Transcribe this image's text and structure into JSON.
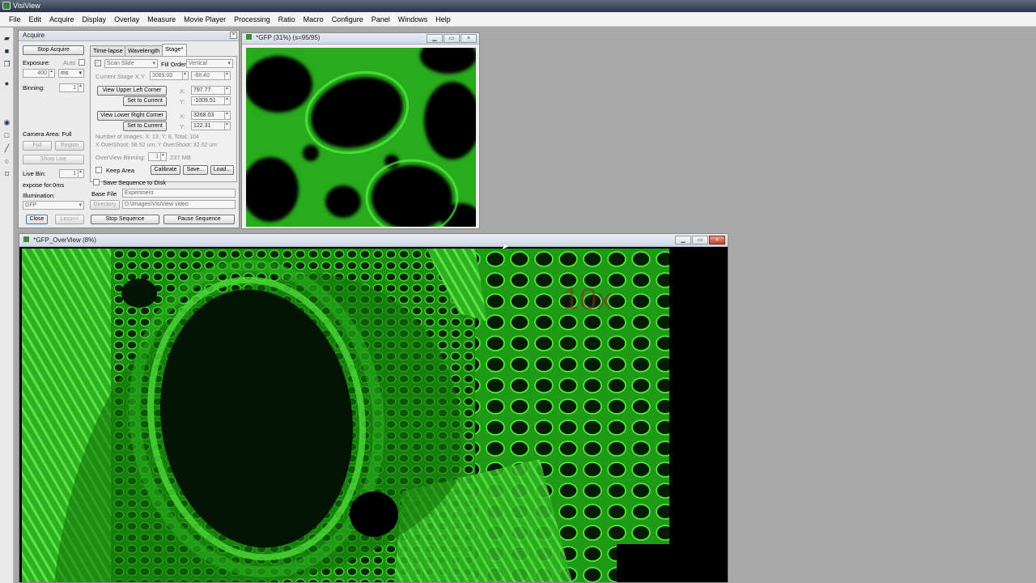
{
  "app": {
    "title": "VisiView"
  },
  "menu": [
    "File",
    "Edit",
    "Acquire",
    "Display",
    "Overlay",
    "Measure",
    "Movie Player",
    "Processing",
    "Ratio",
    "Macro",
    "Configure",
    "Panel",
    "Windows",
    "Help"
  ],
  "acquire": {
    "title": "Acquire",
    "stop_acquire": "Stop Acquire",
    "exposure_label": "Exposure:",
    "auto_label": "Auto",
    "exposure_value": "400",
    "exposure_unit": "ms",
    "binning_label": "Binning:",
    "binning_value": "1",
    "camera_area": "Camera Area: Full",
    "full": "Full",
    "region": "Region",
    "show_live": "Show Live",
    "live_bin_label": "Live Bin:",
    "live_bin_value": "1",
    "expose_for": "expose for:0ms",
    "illumination_label": "Illumination:",
    "illumination_value": "GFP",
    "close": "Close",
    "less": "Less<<",
    "tabs": [
      "Time-lapse",
      "Wavelength",
      "Stage*"
    ],
    "scan_slide": "Scan Slide",
    "fill_order_label": "Fill Order:",
    "fill_order_value": "Vertical",
    "current_stage_label": "Current Stage X,Y",
    "stage_x": "3089.00",
    "stage_y": "-88.40",
    "view_upper_left": "View Upper Left Corner",
    "set_to_current_1": "Set to Current",
    "view_lower_right": "View Lower Right Corner",
    "set_to_current_2": "Set to Current",
    "x_label": "X:",
    "y_label": "Y:",
    "ul_x": "797.77",
    "ul_y": "-1009.51",
    "lr_x": "3268.03",
    "lr_y": "122.31",
    "number_of_images": "Number of Images:  X: 13, Y: 8, Total: 104",
    "overshoot": "X OverShoot: 58.52 um, Y OverShoot: 32.02 um",
    "overview_binning_label": "OverView Binning:",
    "overview_binning_value": "1",
    "overview_size": "237 MB",
    "keep_area": "Keep Area",
    "calibrate": "Calibrate",
    "save": "Save...",
    "load": "Load...",
    "save_sequence": "Save Sequence to Disk",
    "base_file_label": "Base File",
    "base_file_value": "Experiment",
    "directory_label": "Directory",
    "directory_value": "D:\\Images\\VisiView video",
    "stop_sequence": "Stop Sequence",
    "pause_sequence": "Pause Sequence"
  },
  "gfp_window": {
    "title": "*GFP (31%) (s=95/95)"
  },
  "overview_window": {
    "title": "*GFP_OverView (8%)",
    "stamp": "10x"
  },
  "colors": {
    "fluorescence": "#37d62a",
    "background": "#a9a9a9"
  }
}
